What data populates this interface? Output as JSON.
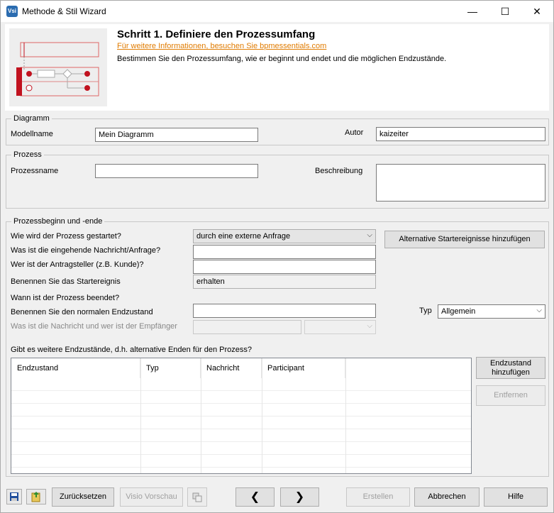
{
  "window": {
    "title": "Methode & Stil Wizard",
    "icon_label": "Vsi",
    "minimize_glyph": "—",
    "maximize_glyph": "☐",
    "close_glyph": "✕"
  },
  "header": {
    "title": "Schritt 1. Definiere den Prozessumfang",
    "link": "Für weitere Informationen, besuchen Sie bpmessentials.com",
    "description": "Bestimmen Sie den Prozessumfang, wie er beginnt und endet und die möglichen Endzustände."
  },
  "diagramm": {
    "legend": "Diagramm",
    "modellname_label": "Modellname",
    "modellname_value": "Mein Diagramm",
    "autor_label": "Autor",
    "autor_value": "kaizeiter"
  },
  "prozess": {
    "legend": "Prozess",
    "prozessname_label": "Prozessname",
    "prozessname_value": "",
    "beschreibung_label": "Beschreibung",
    "beschreibung_value": ""
  },
  "beginn": {
    "legend": "Prozessbeginn und -ende",
    "start_label": "Wie wird der Prozess gestartet?",
    "start_value": "durch eine externe Anfrage",
    "alt_start_button": "Alternative Startereignisse hinzufügen",
    "nachricht_label": "Was ist die eingehende Nachricht/Anfrage?",
    "nachricht_value": "",
    "antragsteller_label": "Wer ist der Antragsteller (z.B. Kunde)?",
    "antragsteller_value": "",
    "startereignis_label": "Benennen Sie das Startereignis",
    "startereignis_value": "erhalten",
    "beendet_label": "Wann ist der Prozess beendet?",
    "endzustand_label": "Benennen Sie den normalen Endzustand",
    "endzustand_value": "",
    "typ_label": "Typ",
    "typ_value": "Allgemein",
    "empfaenger_label": "Was ist die Nachricht und wer ist der Empfänger",
    "empfaenger_value": "",
    "empfaenger_select": "",
    "weitere_label": "Gibt es weitere Endzustände, d.h. alternative Enden für den Prozess?"
  },
  "table": {
    "columns": [
      "Endzustand",
      "Typ",
      "Nachricht",
      "Participant"
    ]
  },
  "side_buttons": {
    "add": "Endzustand hinzufügen",
    "remove": "Entfernen"
  },
  "footer": {
    "reset": "Zurücksetzen",
    "preview": "Visio Vorschau",
    "back": "❮",
    "next": "❯",
    "create": "Erstellen",
    "cancel": "Abbrechen",
    "help": "Hilfe"
  },
  "colors": {
    "accent_red": "#c1121f",
    "link_orange": "#e07b00"
  }
}
